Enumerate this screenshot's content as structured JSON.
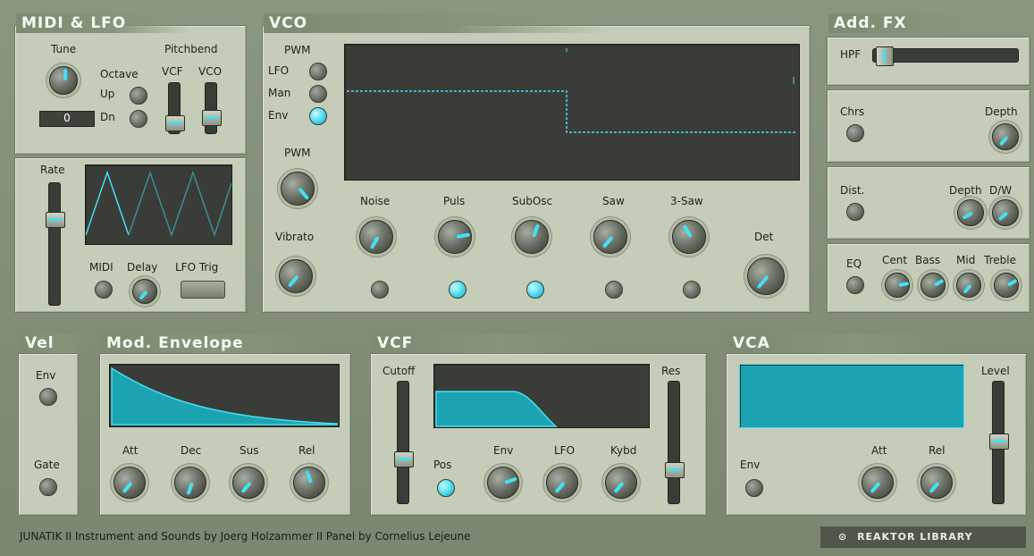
{
  "sections": {
    "midi_lfo": "MIDI & LFO",
    "vco": "VCO",
    "addfx": "Add. FX",
    "vel": "Vel",
    "modenv": "Mod. Envelope",
    "vcf": "VCF",
    "vca": "VCA"
  },
  "midi": {
    "tune": "Tune",
    "pitchbend": "Pitchbend",
    "octave": "Octave",
    "up": "Up",
    "dn": "Dn",
    "vcf": "VCF",
    "vco": "VCO",
    "value": "0"
  },
  "lfo": {
    "rate": "Rate",
    "midi": "MIDI",
    "delay": "Delay",
    "lfo_trig": "LFO Trig"
  },
  "vco": {
    "pwm_head": "PWM",
    "lfo": "LFO",
    "man": "Man",
    "env": "Env",
    "pwm_knob": "PWM",
    "vibrato": "Vibrato",
    "noise": "Noise",
    "puls": "Puls",
    "subosc": "SubOsc",
    "saw": "Saw",
    "saw3": "3-Saw",
    "det": "Det"
  },
  "fx": {
    "hpf": "HPF",
    "chrs": "Chrs",
    "chrs_depth": "Depth",
    "dist": "Dist.",
    "dist_depth": "Depth",
    "dist_dw": "D/W",
    "eq": "EQ",
    "cent": "Cent",
    "bass": "Bass",
    "mid": "Mid",
    "treble": "Treble"
  },
  "vel": {
    "env": "Env",
    "gate": "Gate"
  },
  "modenv": {
    "att": "Att",
    "dec": "Dec",
    "sus": "Sus",
    "rel": "Rel"
  },
  "vcf": {
    "cutoff": "Cutoff",
    "res": "Res",
    "pos": "Pos",
    "env": "Env",
    "lfo": "LFO",
    "kybd": "Kybd"
  },
  "vca": {
    "env": "Env",
    "att": "Att",
    "rel": "Rel",
    "level": "Level"
  },
  "footer": "JUNATIK  II  Instrument and Sounds by Joerg Holzammer  II  Panel by Cornelius Lejeune",
  "brand": "REAKTOR LIBRARY",
  "colors": {
    "accent": "#44e0f3",
    "panel": "#c5cdb8",
    "screen": "#3a3c38"
  }
}
